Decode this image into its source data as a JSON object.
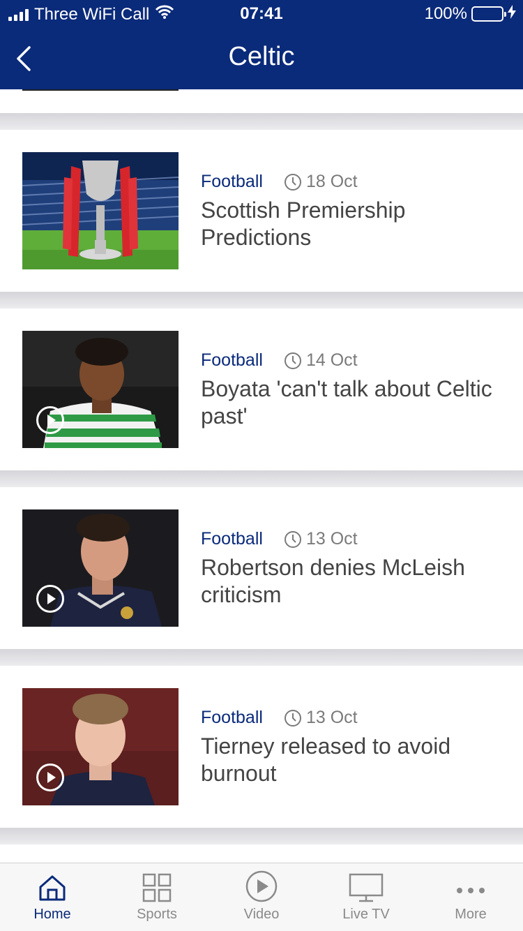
{
  "status_bar": {
    "carrier": "Three WiFi Call",
    "time": "07:41",
    "battery": "100%"
  },
  "header": {
    "title": "Celtic"
  },
  "articles": [
    {
      "category": "Football",
      "date": "18 Oct",
      "headline": "Scottish Premiership Predictions",
      "has_video": false
    },
    {
      "category": "Football",
      "date": "14 Oct",
      "headline": "Boyata 'can't talk about Celtic past'",
      "has_video": true
    },
    {
      "category": "Football",
      "date": "13 Oct",
      "headline": "Robertson denies McLeish criticism",
      "has_video": true
    },
    {
      "category": "Football",
      "date": "13 Oct",
      "headline": "Tierney released to avoid burnout",
      "has_video": true
    }
  ],
  "tabs": [
    {
      "label": "Home",
      "icon": "home-icon",
      "active": true
    },
    {
      "label": "Sports",
      "icon": "grid-icon",
      "active": false
    },
    {
      "label": "Video",
      "icon": "play-circle-icon",
      "active": false
    },
    {
      "label": "Live TV",
      "icon": "tv-icon",
      "active": false
    },
    {
      "label": "More",
      "icon": "more-icon",
      "active": false
    }
  ],
  "colors": {
    "brand": "#0a2a7a",
    "battery": "#4cd964",
    "inactive": "#8a8a8a"
  }
}
